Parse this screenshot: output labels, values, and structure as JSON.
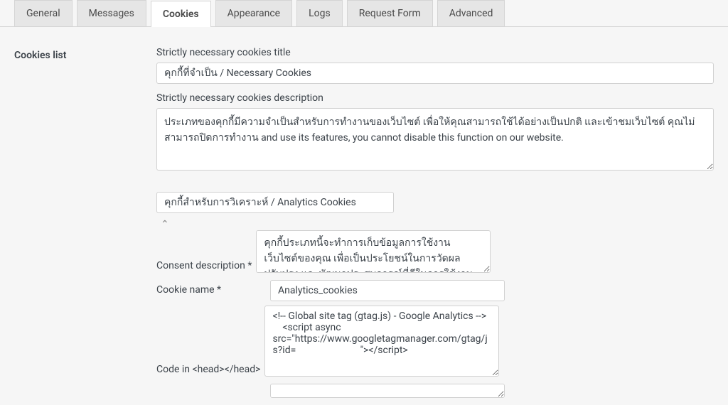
{
  "tabs": {
    "general": "General",
    "messages": "Messages",
    "cookies": "Cookies",
    "appearance": "Appearance",
    "logs": "Logs",
    "request_form": "Request Form",
    "advanced": "Advanced"
  },
  "section_title": "Cookies list",
  "strictly_necessary": {
    "title_label": "Strictly necessary cookies title",
    "title_value": "คุกกี้ที่จำเป็น / Necessary Cookies",
    "desc_label": "Strictly necessary cookies description",
    "desc_value": "ประเภทของคุกกี้มีความจำเป็นสำหรับการทำงานของเว็บไซต์ เพื่อให้คุณสามารถใช้ได้อย่างเป็นปกติ และเข้าชมเว็บไซต์ คุณไม่สามารถปิดการทำงาน and use its features, you cannot disable this function on our website."
  },
  "cookie_group": {
    "title_value": "คุกกี้สำหรับการวิเคราะห์ / Analytics Cookies",
    "consent_desc_label": "Consent description *",
    "consent_desc_value": "คุกกี้ประเภทนี้จะทำการเก็บข้อมูลการใช้งานเว็บไซต์ของคุณ เพื่อเป็นประโยชน์ในการวัดผล ปรับปรุง และพัฒนาประสบการณ์ที่ดีในการใช้งานเว็บไซต์ ถ้าหากท่านไม่",
    "cookie_name_label": "Cookie name *",
    "cookie_name_value": "Analytics_cookies",
    "code_head_label": "Code in <head></head>",
    "code_head_value": "<!-- Global site tag (gtag.js) - Google Analytics -->\n    <script async src=\"https://www.googletagmanager.com/gtag/js?id=                          \"></script>"
  }
}
